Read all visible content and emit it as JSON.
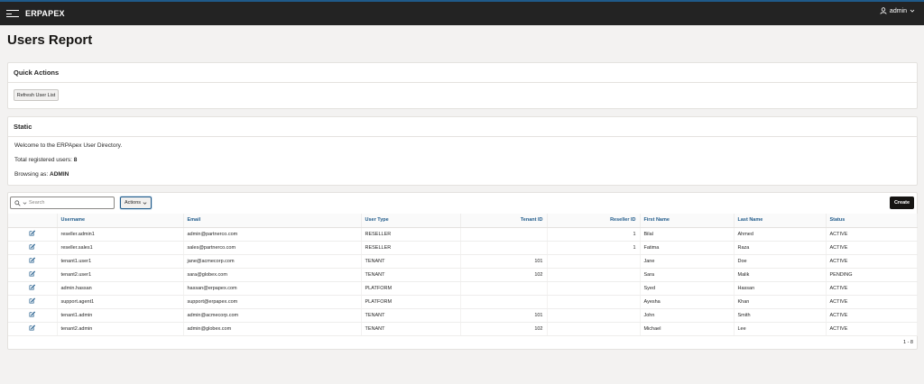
{
  "app": {
    "logo": "ERPAPEX",
    "user": "admin"
  },
  "page": {
    "title": "Users Report"
  },
  "quick_actions": {
    "title": "Quick Actions",
    "refresh_label": "Refresh User List"
  },
  "static": {
    "title": "Static",
    "welcome": "Welcome to the ERPApex User Directory.",
    "total_label": "Total registered users: ",
    "total_value": "8",
    "browsing_label": "Browsing as: ",
    "browsing_value": "ADMIN"
  },
  "grid": {
    "search_placeholder": "Search",
    "actions_label": "Actions",
    "create_label": "Create",
    "columns": [
      "Username",
      "Email",
      "User Type",
      "Tenant ID",
      "Reseller ID",
      "First Name",
      "Last Name",
      "Status"
    ],
    "rows": [
      [
        "reseller.admin1",
        "admin@partnerco.com",
        "RESELLER",
        "",
        "1",
        "Bilal",
        "Ahmed",
        "ACTIVE"
      ],
      [
        "reseller.sales1",
        "sales@partnerco.com",
        "RESELLER",
        "",
        "1",
        "Fatima",
        "Raza",
        "ACTIVE"
      ],
      [
        "tenant1.user1",
        "jane@acmecorp.com",
        "TENANT",
        "101",
        "",
        "Jane",
        "Doe",
        "ACTIVE"
      ],
      [
        "tenant2.user1",
        "sara@globex.com",
        "TENANT",
        "102",
        "",
        "Sara",
        "Malik",
        "PENDING"
      ],
      [
        "admin.hassan",
        "hassan@erpapex.com",
        "PLATFORM",
        "",
        "",
        "Syed",
        "Hassan",
        "ACTIVE"
      ],
      [
        "support.agent1",
        "support@erpapex.com",
        "PLATFORM",
        "",
        "",
        "Ayesha",
        "Khan",
        "ACTIVE"
      ],
      [
        "tenant1.admin",
        "admin@acmecorp.com",
        "TENANT",
        "101",
        "",
        "John",
        "Smith",
        "ACTIVE"
      ],
      [
        "tenant2.admin",
        "admin@globex.com",
        "TENANT",
        "102",
        "",
        "Michael",
        "Lee",
        "ACTIVE"
      ]
    ],
    "pagination": "1 - 8"
  },
  "colors": {
    "accent": "#1f5a8a",
    "topbar": "#232323",
    "background": "#f3f2f1"
  }
}
